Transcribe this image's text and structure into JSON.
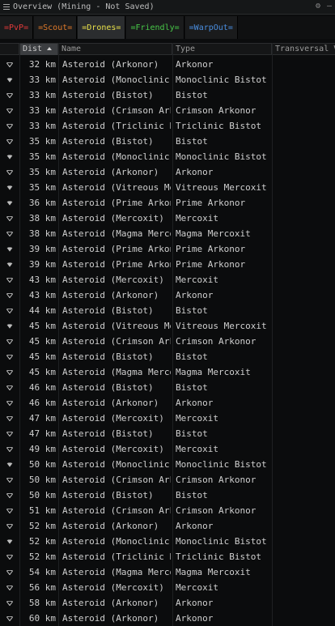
{
  "window": {
    "title": "Overview (Mining - Not Saved)"
  },
  "tabs": [
    {
      "label": "=PvP=",
      "color": "#e03a3a",
      "active": false
    },
    {
      "label": "=Scout=",
      "color": "#e07a2a",
      "active": false
    },
    {
      "label": "=Drones=",
      "color": "#e8e04a",
      "active": true
    },
    {
      "label": "=Friendly=",
      "color": "#48c848",
      "active": false
    },
    {
      "label": "=WarpOut=",
      "color": "#4a8ee0",
      "active": false
    }
  ],
  "columns": {
    "distance": "Dist",
    "name": "Name",
    "type": "Type",
    "transversal": "Transversal V"
  },
  "rows": [
    {
      "icon": "asteroid-small-icon",
      "dist": "32 km",
      "name": "Asteroid (Arkonor)",
      "type": "Arkonor"
    },
    {
      "icon": "asteroid-large-icon",
      "dist": "33 km",
      "name": "Asteroid (Monoclinic Bist",
      "type": "Monoclinic Bistot"
    },
    {
      "icon": "asteroid-small-icon",
      "dist": "33 km",
      "name": "Asteroid (Bistot)",
      "type": "Bistot"
    },
    {
      "icon": "asteroid-small-icon",
      "dist": "33 km",
      "name": "Asteroid (Crimson Arkon",
      "type": "Crimson Arkonor"
    },
    {
      "icon": "asteroid-small-icon",
      "dist": "33 km",
      "name": "Asteroid (Triclinic Bistot)",
      "type": "Triclinic Bistot"
    },
    {
      "icon": "asteroid-small-icon",
      "dist": "35 km",
      "name": "Asteroid (Bistot)",
      "type": "Bistot"
    },
    {
      "icon": "asteroid-large-icon",
      "dist": "35 km",
      "name": "Asteroid (Monoclinic Bist",
      "type": "Monoclinic Bistot"
    },
    {
      "icon": "asteroid-small-icon",
      "dist": "35 km",
      "name": "Asteroid (Arkonor)",
      "type": "Arkonor"
    },
    {
      "icon": "asteroid-large-icon",
      "dist": "35 km",
      "name": "Asteroid (Vitreous Merco",
      "type": "Vitreous Mercoxit"
    },
    {
      "icon": "asteroid-large-icon",
      "dist": "36 km",
      "name": "Asteroid (Prime Arkonor)",
      "type": "Prime Arkonor"
    },
    {
      "icon": "asteroid-small-icon",
      "dist": "38 km",
      "name": "Asteroid (Mercoxit)",
      "type": "Mercoxit"
    },
    {
      "icon": "asteroid-small-icon",
      "dist": "38 km",
      "name": "Asteroid (Magma Mercoxi",
      "type": "Magma Mercoxit"
    },
    {
      "icon": "asteroid-large-icon",
      "dist": "39 km",
      "name": "Asteroid (Prime Arkonor)",
      "type": "Prime Arkonor"
    },
    {
      "icon": "asteroid-large-icon",
      "dist": "39 km",
      "name": "Asteroid (Prime Arkonor)",
      "type": "Prime Arkonor"
    },
    {
      "icon": "asteroid-small-icon",
      "dist": "43 km",
      "name": "Asteroid (Mercoxit)",
      "type": "Mercoxit"
    },
    {
      "icon": "asteroid-small-icon",
      "dist": "43 km",
      "name": "Asteroid (Arkonor)",
      "type": "Arkonor"
    },
    {
      "icon": "asteroid-small-icon",
      "dist": "44 km",
      "name": "Asteroid (Bistot)",
      "type": "Bistot"
    },
    {
      "icon": "asteroid-large-icon",
      "dist": "45 km",
      "name": "Asteroid (Vitreous Merco",
      "type": "Vitreous Mercoxit"
    },
    {
      "icon": "asteroid-small-icon",
      "dist": "45 km",
      "name": "Asteroid (Crimson Arkon",
      "type": "Crimson Arkonor"
    },
    {
      "icon": "asteroid-small-icon",
      "dist": "45 km",
      "name": "Asteroid (Bistot)",
      "type": "Bistot"
    },
    {
      "icon": "asteroid-small-icon",
      "dist": "45 km",
      "name": "Asteroid (Magma Mercoxi",
      "type": "Magma Mercoxit"
    },
    {
      "icon": "asteroid-small-icon",
      "dist": "46 km",
      "name": "Asteroid (Bistot)",
      "type": "Bistot"
    },
    {
      "icon": "asteroid-small-icon",
      "dist": "46 km",
      "name": "Asteroid (Arkonor)",
      "type": "Arkonor"
    },
    {
      "icon": "asteroid-small-icon",
      "dist": "47 km",
      "name": "Asteroid (Mercoxit)",
      "type": "Mercoxit"
    },
    {
      "icon": "asteroid-small-icon",
      "dist": "47 km",
      "name": "Asteroid (Bistot)",
      "type": "Bistot"
    },
    {
      "icon": "asteroid-small-icon",
      "dist": "49 km",
      "name": "Asteroid (Mercoxit)",
      "type": "Mercoxit"
    },
    {
      "icon": "asteroid-large-icon",
      "dist": "50 km",
      "name": "Asteroid (Monoclinic Bist",
      "type": "Monoclinic Bistot"
    },
    {
      "icon": "asteroid-small-icon",
      "dist": "50 km",
      "name": "Asteroid (Crimson Arkon",
      "type": "Crimson Arkonor"
    },
    {
      "icon": "asteroid-small-icon",
      "dist": "50 km",
      "name": "Asteroid (Bistot)",
      "type": "Bistot"
    },
    {
      "icon": "asteroid-small-icon",
      "dist": "51 km",
      "name": "Asteroid (Crimson Arkon",
      "type": "Crimson Arkonor"
    },
    {
      "icon": "asteroid-small-icon",
      "dist": "52 km",
      "name": "Asteroid (Arkonor)",
      "type": "Arkonor"
    },
    {
      "icon": "asteroid-large-icon",
      "dist": "52 km",
      "name": "Asteroid (Monoclinic Bist",
      "type": "Monoclinic Bistot"
    },
    {
      "icon": "asteroid-small-icon",
      "dist": "52 km",
      "name": "Asteroid (Triclinic Bistot)",
      "type": "Triclinic Bistot"
    },
    {
      "icon": "asteroid-small-icon",
      "dist": "54 km",
      "name": "Asteroid (Magma Mercoxi",
      "type": "Magma Mercoxit"
    },
    {
      "icon": "asteroid-small-icon",
      "dist": "56 km",
      "name": "Asteroid (Mercoxit)",
      "type": "Mercoxit"
    },
    {
      "icon": "asteroid-small-icon",
      "dist": "58 km",
      "name": "Asteroid (Arkonor)",
      "type": "Arkonor"
    },
    {
      "icon": "asteroid-small-icon",
      "dist": "60 km",
      "name": "Asteroid (Arkonor)",
      "type": "Arkonor"
    }
  ]
}
